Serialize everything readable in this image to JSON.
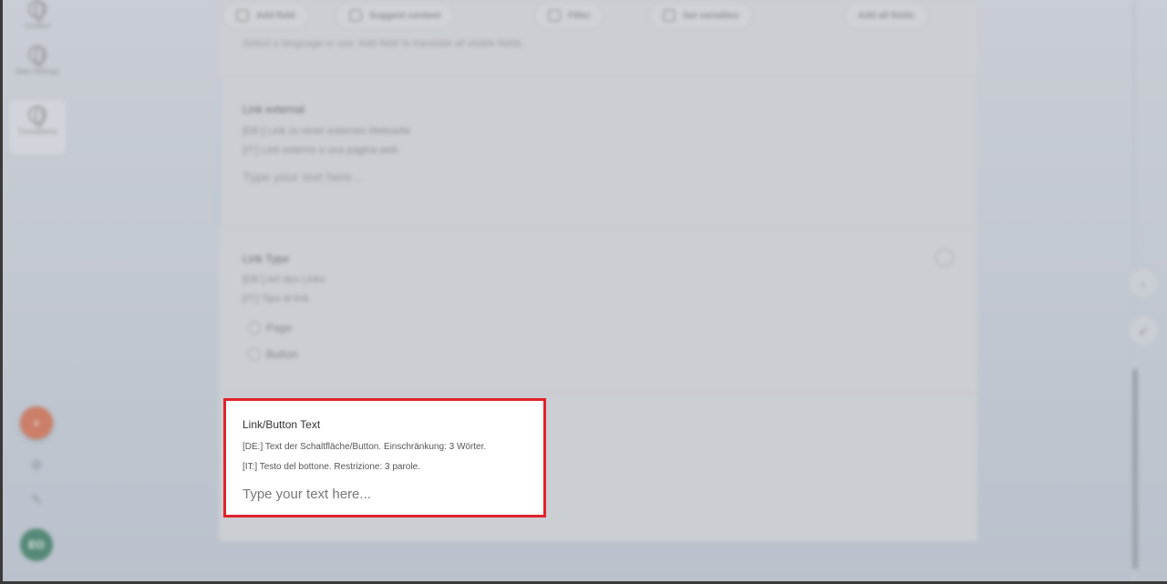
{
  "background": {
    "toolbar": [
      "Add field",
      "Suggest content",
      "Filter",
      "Set variables",
      "Add all fields"
    ],
    "note": "Select a language or use ‘Add field’ to translate all visible fields.",
    "sections": [
      {
        "title": "Link external",
        "de": "[DE:] Link zu einer externen Webseite",
        "it": "[IT:] Link esterno a una pagina web",
        "placeholder": "Type your text here..."
      },
      {
        "title": "Link Type",
        "de": "[DE:] Art des Links",
        "it": "[IT:] Tipo di link",
        "options": [
          "Page",
          "Button"
        ]
      }
    ],
    "sidebar": [
      "Content",
      "Web Settings",
      "Translations"
    ],
    "avatar_initials": "EO"
  },
  "field": {
    "title": "Link/Button Text",
    "de_hint": "[DE:] Text der Schaltfläche/Button. Einschränkung: 3 Wörter.",
    "it_hint": "[IT:] Testo del bottone. Restrizione: 3 parole.",
    "placeholder": "Type your text here...",
    "value": ""
  },
  "colors": {
    "highlight_border": "#e0222b",
    "fab_orange": "#d35a33",
    "avatar_green": "#1f6b4a"
  },
  "icons": {
    "toolbar": "grid-icon",
    "fab": "plus-circle-icon",
    "right_rail": [
      "collapse-icon",
      "rocket-icon"
    ]
  }
}
